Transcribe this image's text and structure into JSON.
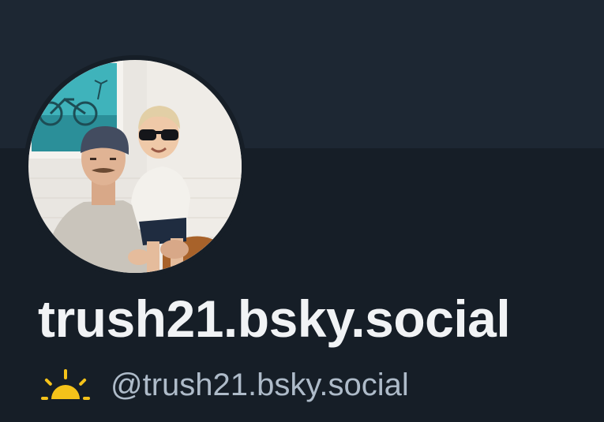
{
  "profile": {
    "display_name": "trush21.bsky.social",
    "handle": "@trush21.bsky.social",
    "avatar": "avatar-photo-man-and-child",
    "status_icon": "sun-icon"
  },
  "colors": {
    "background": "#161e27",
    "banner": "#1d2733",
    "display_name": "#f1f3f5",
    "handle": "#aebbc9",
    "sun": "#f4c21a"
  }
}
